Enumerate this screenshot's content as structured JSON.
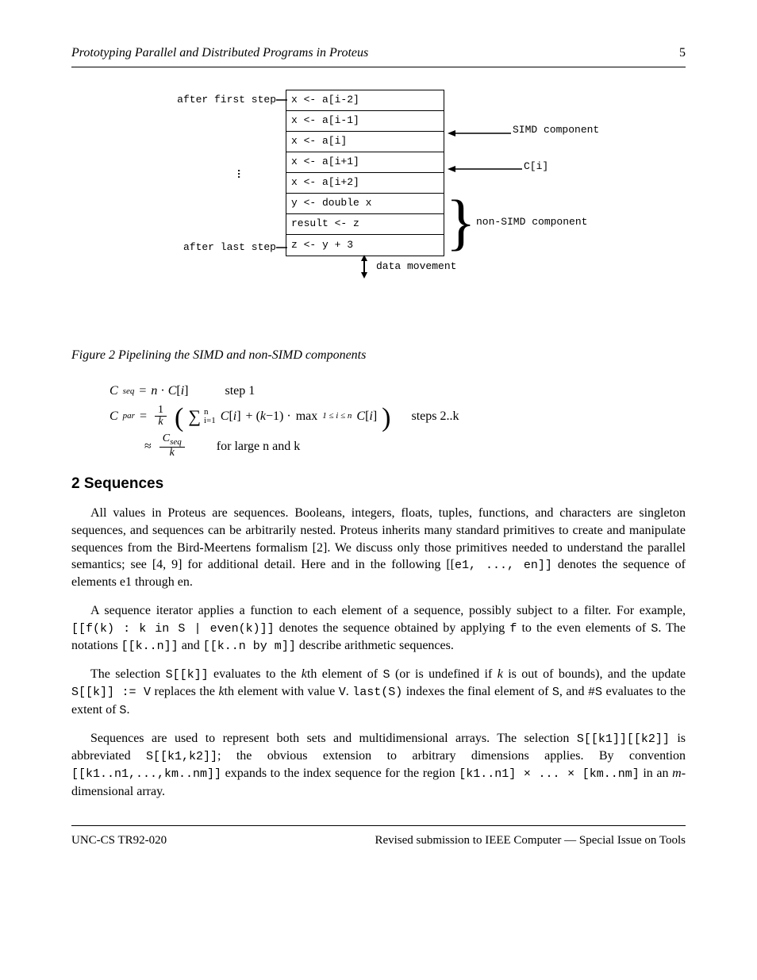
{
  "header": {
    "left": "Prototyping Parallel and Distributed Programs in Proteus",
    "right": "5"
  },
  "figure": {
    "cells": [
      "x <- a[i-2]",
      "x <- a[i-1]",
      "x <- a[i]",
      "x <- a[i+1]",
      "x <- a[i+2]",
      "y <- double x",
      "result <- z",
      "z <- y + 3"
    ],
    "labels": {
      "simd_comp": "SIMD component",
      "c_i": "C[i]",
      "non_simd": "non-SIMD component",
      "movement": "data movement",
      "after_first": "after first step",
      "after_last": "after last step"
    },
    "caption": "Figure 2  Pipelining the SIMD and non-SIMD components"
  },
  "section_title": "2  Sequences",
  "paragraphs": {
    "p1_pre": "All values in Proteus are sequences. Booleans, integers, floats, tuples, functions, and characters are singleton sequences, and sequences can be arbitrarily nested. Proteus inherits many standard primitives to create and manipulate sequences from the Bird-Meertens formalism [2]. We discuss only those primitives needed to understand the parallel semantics; see [4, 9] for additional detail. Here and in the following [[",
    "p1_seq": "e1, ..., en]]",
    "p1_post": " denotes the sequence of elements e1 through en.",
    "p2_pre": "A sequence iterator applies a function to each element of a sequence, possibly subject to a filter. For example, ",
    "p2_code1": "[[f(k) : k in S | even(k)]]",
    "p2_mid": " denotes the sequence obtained by applying ",
    "p2_f": "f",
    "p2_mid2": " to the even elements of ",
    "p2_S": "S",
    "p2_mid3": ". The notations ",
    "p2_code2": "[[k..n]]",
    "p2_and": " and ",
    "p2_code3": "[[k..n by m]]",
    "p2_post": " describe arithmetic sequences.",
    "p3_pre": "The selection ",
    "p3_code1": "S[[k]]",
    "p3_mid1": " evaluates to the ",
    "p3_k": "k",
    "p3_mid2": "th element of ",
    "p3_S": "S",
    "p3_mid3": " (or is undefined if ",
    "p3_k2": "k",
    "p3_mid4": " is out of bounds), and the update ",
    "p3_code2": "S[[k]] := V",
    "p3_mid5": " replaces the ",
    "p3_k3": "k",
    "p3_mid6": "th element with value ",
    "p3_V": "V",
    "p3_mid7": ". ",
    "p3_code3": "last(S)",
    "p3_mid8": " indexes the final element of ",
    "p3_S2": "S",
    "p3_mid9": ", and ",
    "p3_code4": "#S",
    "p3_mid10": " evaluates to the extent of ",
    "p3_S3": "S",
    "p3_post": ".",
    "p4_pre": "Sequences are used to represent both sets and multidimensional arrays. The selection ",
    "p4_code1": "S[[k1]][[k2]]",
    "p4_mid": " is abbreviated ",
    "p4_code2": "S[[k1,k2]]",
    "p4_mid2": "; the obvious extension to arbitrary dimensions applies. By convention ",
    "p4_code3": "[[k1..n1,...,km..nm]]",
    "p4_mid3": " expands to the index sequence for the region ",
    "p4_code4": "[k1..n1] × ... × [km..nm]",
    "p4_mid4": " in an ",
    "p4_m": "m",
    "p4_post": "-dimensional array."
  },
  "formula": {
    "lhs_sym": "C",
    "lhs_sub": "seq",
    "step1": "step 1",
    "sum_upper": "n",
    "sum_lower": "i=1",
    "C": "C",
    "i": "i",
    "step2_lhs": "steps 2..k",
    "max_label": "max",
    "i_in": "1 ≤ i ≤ n",
    "step3_pre": "≈",
    "k_var": "k",
    "Cpar": "C",
    "par_sub": "par",
    "trailing": "for large n and k"
  },
  "footer": {
    "left": "UNC-CS  TR92-020",
    "right": "Revised submission to IEEE Computer — Special Issue on Tools"
  }
}
